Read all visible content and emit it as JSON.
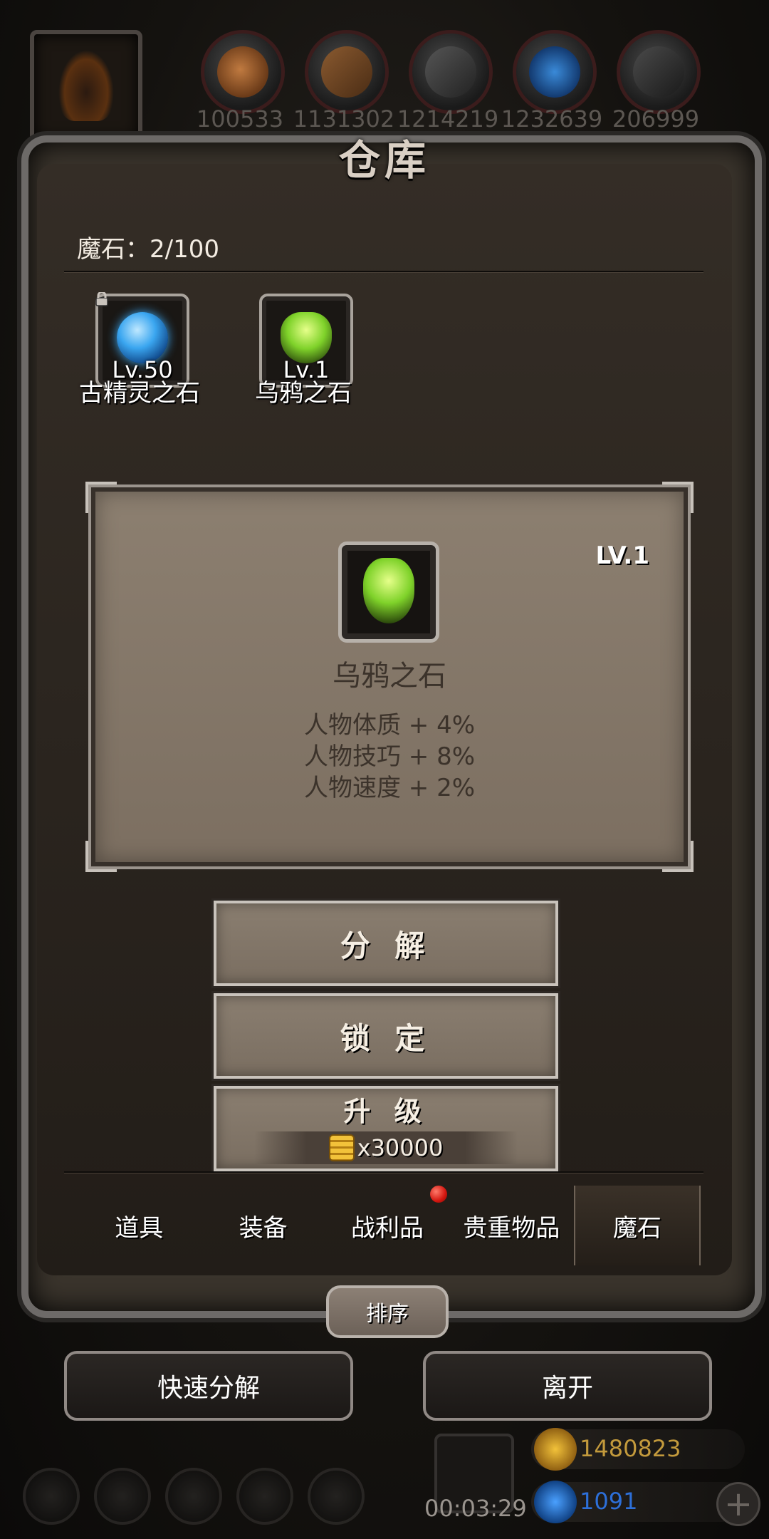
{
  "header": {
    "title": "仓库",
    "resources": [
      {
        "icon": "meat-icon",
        "value": "100533"
      },
      {
        "icon": "wood-icon",
        "value": "1131302"
      },
      {
        "icon": "iron-icon",
        "value": "1214219"
      },
      {
        "icon": "crystal-icon",
        "value": "1232639"
      },
      {
        "icon": "stone-icon",
        "value": "206999"
      }
    ]
  },
  "warehouse": {
    "capacity_label": "魔石：2/100",
    "items": [
      {
        "name": "古精灵之石",
        "level": "Lv.50",
        "locked": true,
        "color": "#3aa6f0"
      },
      {
        "name": "乌鸦之石",
        "level": "Lv.1",
        "locked": false,
        "color": "#7fd22a"
      }
    ]
  },
  "detail": {
    "level": "LV.1",
    "name": "乌鸦之石",
    "stats": [
      "人物体质 + 4%",
      "人物技巧 + 8%",
      "人物速度 + 2%"
    ]
  },
  "actions": {
    "decompose": "分 解",
    "lock": "锁 定",
    "upgrade": "升 级",
    "upgrade_cost": "x30000"
  },
  "tabs": {
    "items": [
      "道具",
      "装备",
      "战利品",
      "贵重物品",
      "魔石"
    ],
    "active_index": 4
  },
  "sort_label": "排序",
  "bottom": {
    "quick_decompose": "快速分解",
    "leave": "离开"
  },
  "footer": {
    "timer": "00:03:29",
    "gold": "1480823",
    "gems": "1091"
  },
  "colors": {
    "gold_text": "#c39a3c",
    "gem_text": "#2d6fd8",
    "notification": "#d3160f"
  }
}
